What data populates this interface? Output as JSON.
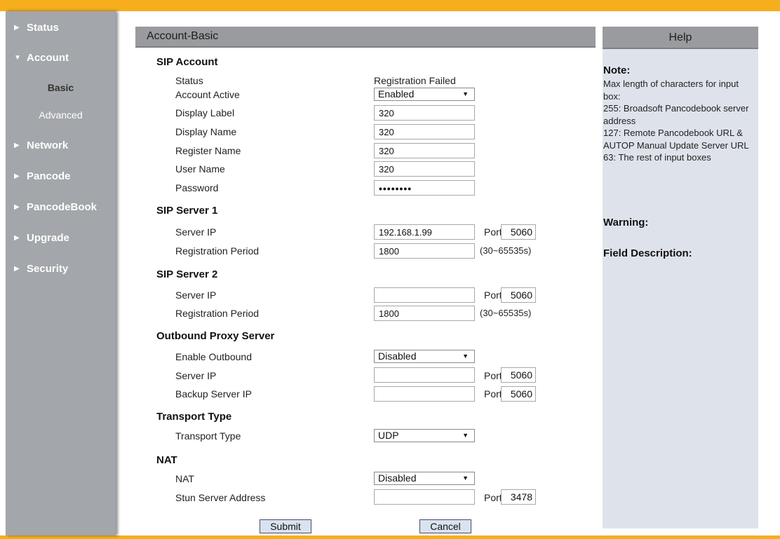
{
  "sidebar": {
    "items": [
      {
        "label": "Status",
        "arrow": "▶"
      },
      {
        "label": "Account",
        "arrow": "▼"
      },
      {
        "label": "Network",
        "arrow": "▶"
      },
      {
        "label": "Pancode",
        "arrow": "▶"
      },
      {
        "label": "PancodeBook",
        "arrow": "▶"
      },
      {
        "label": "Upgrade",
        "arrow": "▶"
      },
      {
        "label": "Security",
        "arrow": "▶"
      }
    ],
    "account_subitems": [
      {
        "label": "Basic",
        "active": true
      },
      {
        "label": "Advanced",
        "active": false
      }
    ]
  },
  "main": {
    "title": "Account-Basic",
    "sip_account": {
      "title": "SIP Account",
      "status_label": "Status",
      "status_value": "Registration Failed",
      "account_active_label": "Account Active",
      "account_active_value": "Enabled",
      "display_label_label": "Display Label",
      "display_label_value": "320",
      "display_name_label": "Display Name",
      "display_name_value": "320",
      "register_name_label": "Register Name",
      "register_name_value": "320",
      "user_name_label": "User Name",
      "user_name_value": "320",
      "password_label": "Password",
      "password_value": "••••••••"
    },
    "sip_server_1": {
      "title": "SIP Server 1",
      "server_ip_label": "Server IP",
      "server_ip_value": "192.168.1.99",
      "port_label": "Port",
      "port_value": "5060",
      "reg_period_label": "Registration Period",
      "reg_period_value": "1800",
      "reg_period_range": "(30~65535s)"
    },
    "sip_server_2": {
      "title": "SIP Server 2",
      "server_ip_label": "Server IP",
      "server_ip_value": "",
      "port_label": "Port",
      "port_value": "5060",
      "reg_period_label": "Registration Period",
      "reg_period_value": "1800",
      "reg_period_range": "(30~65535s)"
    },
    "outbound_proxy": {
      "title": "Outbound Proxy Server",
      "enable_label": "Enable Outbound",
      "enable_value": "Disabled",
      "server_ip_label": "Server IP",
      "server_ip_value": "",
      "server_port_label": "Port",
      "server_port_value": "5060",
      "backup_ip_label": "Backup Server IP",
      "backup_ip_value": "",
      "backup_port_label": "Port",
      "backup_port_value": "5060"
    },
    "transport": {
      "title": "Transport Type",
      "type_label": "Transport Type",
      "type_value": "UDP"
    },
    "nat": {
      "title": "NAT",
      "nat_label": "NAT",
      "nat_value": "Disabled",
      "stun_label": "Stun Server Address",
      "stun_value": "",
      "stun_port_label": "Port",
      "stun_port_value": "3478"
    },
    "buttons": {
      "submit": "Submit",
      "cancel": "Cancel"
    }
  },
  "help": {
    "title": "Help",
    "note_heading": "Note:",
    "note_lines": [
      "Max length of characters for input box:",
      "255: Broadsoft Pancodebook server address",
      "127: Remote Pancodebook URL & AUTOP Manual Update Server URL",
      "63: The rest of input boxes"
    ],
    "warning_heading": "Warning:",
    "field_desc_heading": "Field Description:"
  },
  "colors": {
    "accent_bar": "#f6ae1c",
    "sidebar_bg": "#a3a6aa",
    "header_bg": "#999b9e",
    "help_bg": "#dee3eb",
    "button_bg": "#d9e3ef"
  },
  "icons": {
    "expand": "triangle-right-icon",
    "collapse": "triangle-down-icon",
    "dropdown": "dropdown-caret-icon"
  }
}
